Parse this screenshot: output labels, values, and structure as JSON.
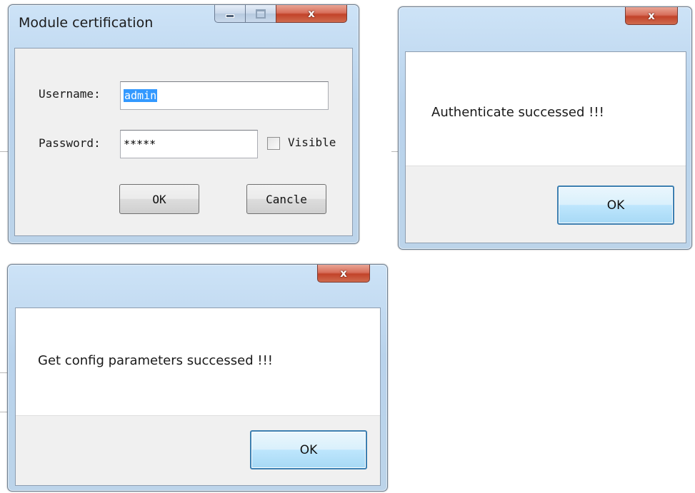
{
  "login_dialog": {
    "title": "Module certification",
    "username_label": "Username:",
    "username_value": "admin",
    "password_label": "Password:",
    "password_value": "*****",
    "visible_label": "Visible",
    "visible_checked": false,
    "ok_label": "OK",
    "cancel_label": "Cancle",
    "icons": [
      "minimize-icon",
      "maximize-icon",
      "close-icon"
    ]
  },
  "auth_message_box": {
    "message": "Authenticate successed !!!",
    "ok_label": "OK",
    "icons": [
      "close-icon"
    ]
  },
  "config_message_box": {
    "message": "Get config parameters successed !!!",
    "ok_label": "OK",
    "icons": [
      "close-icon"
    ]
  },
  "colors": {
    "frame": "#c4dbf1",
    "close_button": "#c7472d",
    "selection": "#3399ff",
    "default_button_border": "#3c7fb1"
  }
}
